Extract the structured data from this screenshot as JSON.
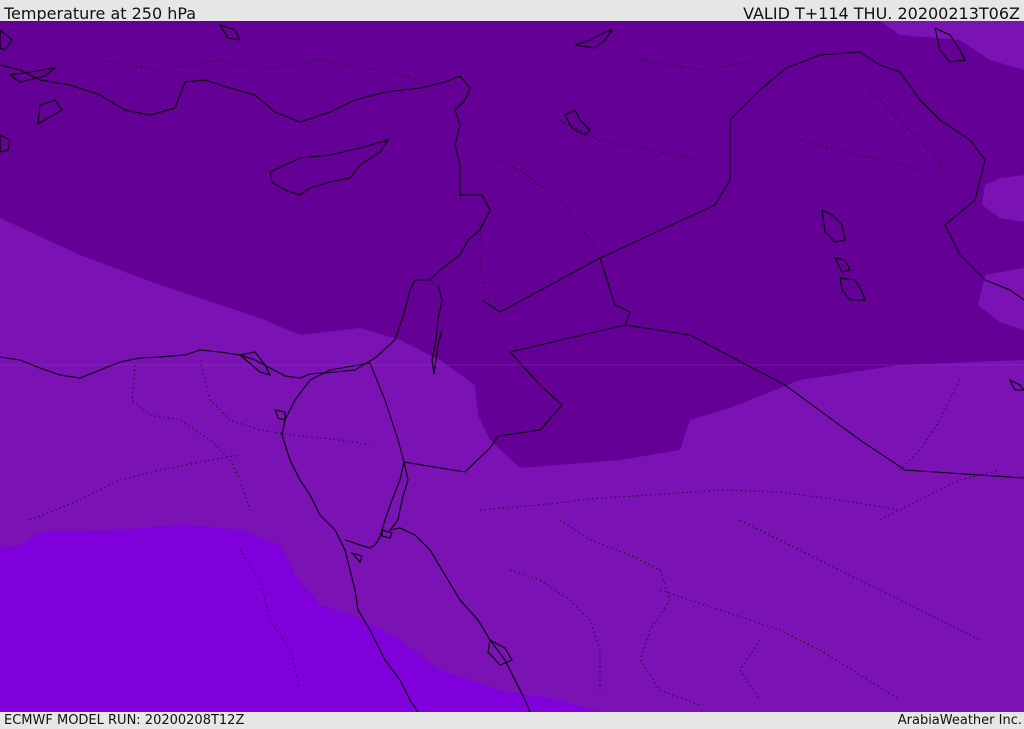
{
  "header": {
    "title": "Temperature at 250 hPa",
    "valid": "VALID T+114 THU. 20200213T06Z"
  },
  "footer": {
    "model_run": "ECMWF MODEL RUN: 20200208T12Z",
    "credit": "ArabiaWeather Inc."
  },
  "colors": {
    "coldest": "#640096",
    "cold": "#7a12b4",
    "cool": "#8000dc",
    "coastline": "#000000",
    "borders": "#000000"
  }
}
